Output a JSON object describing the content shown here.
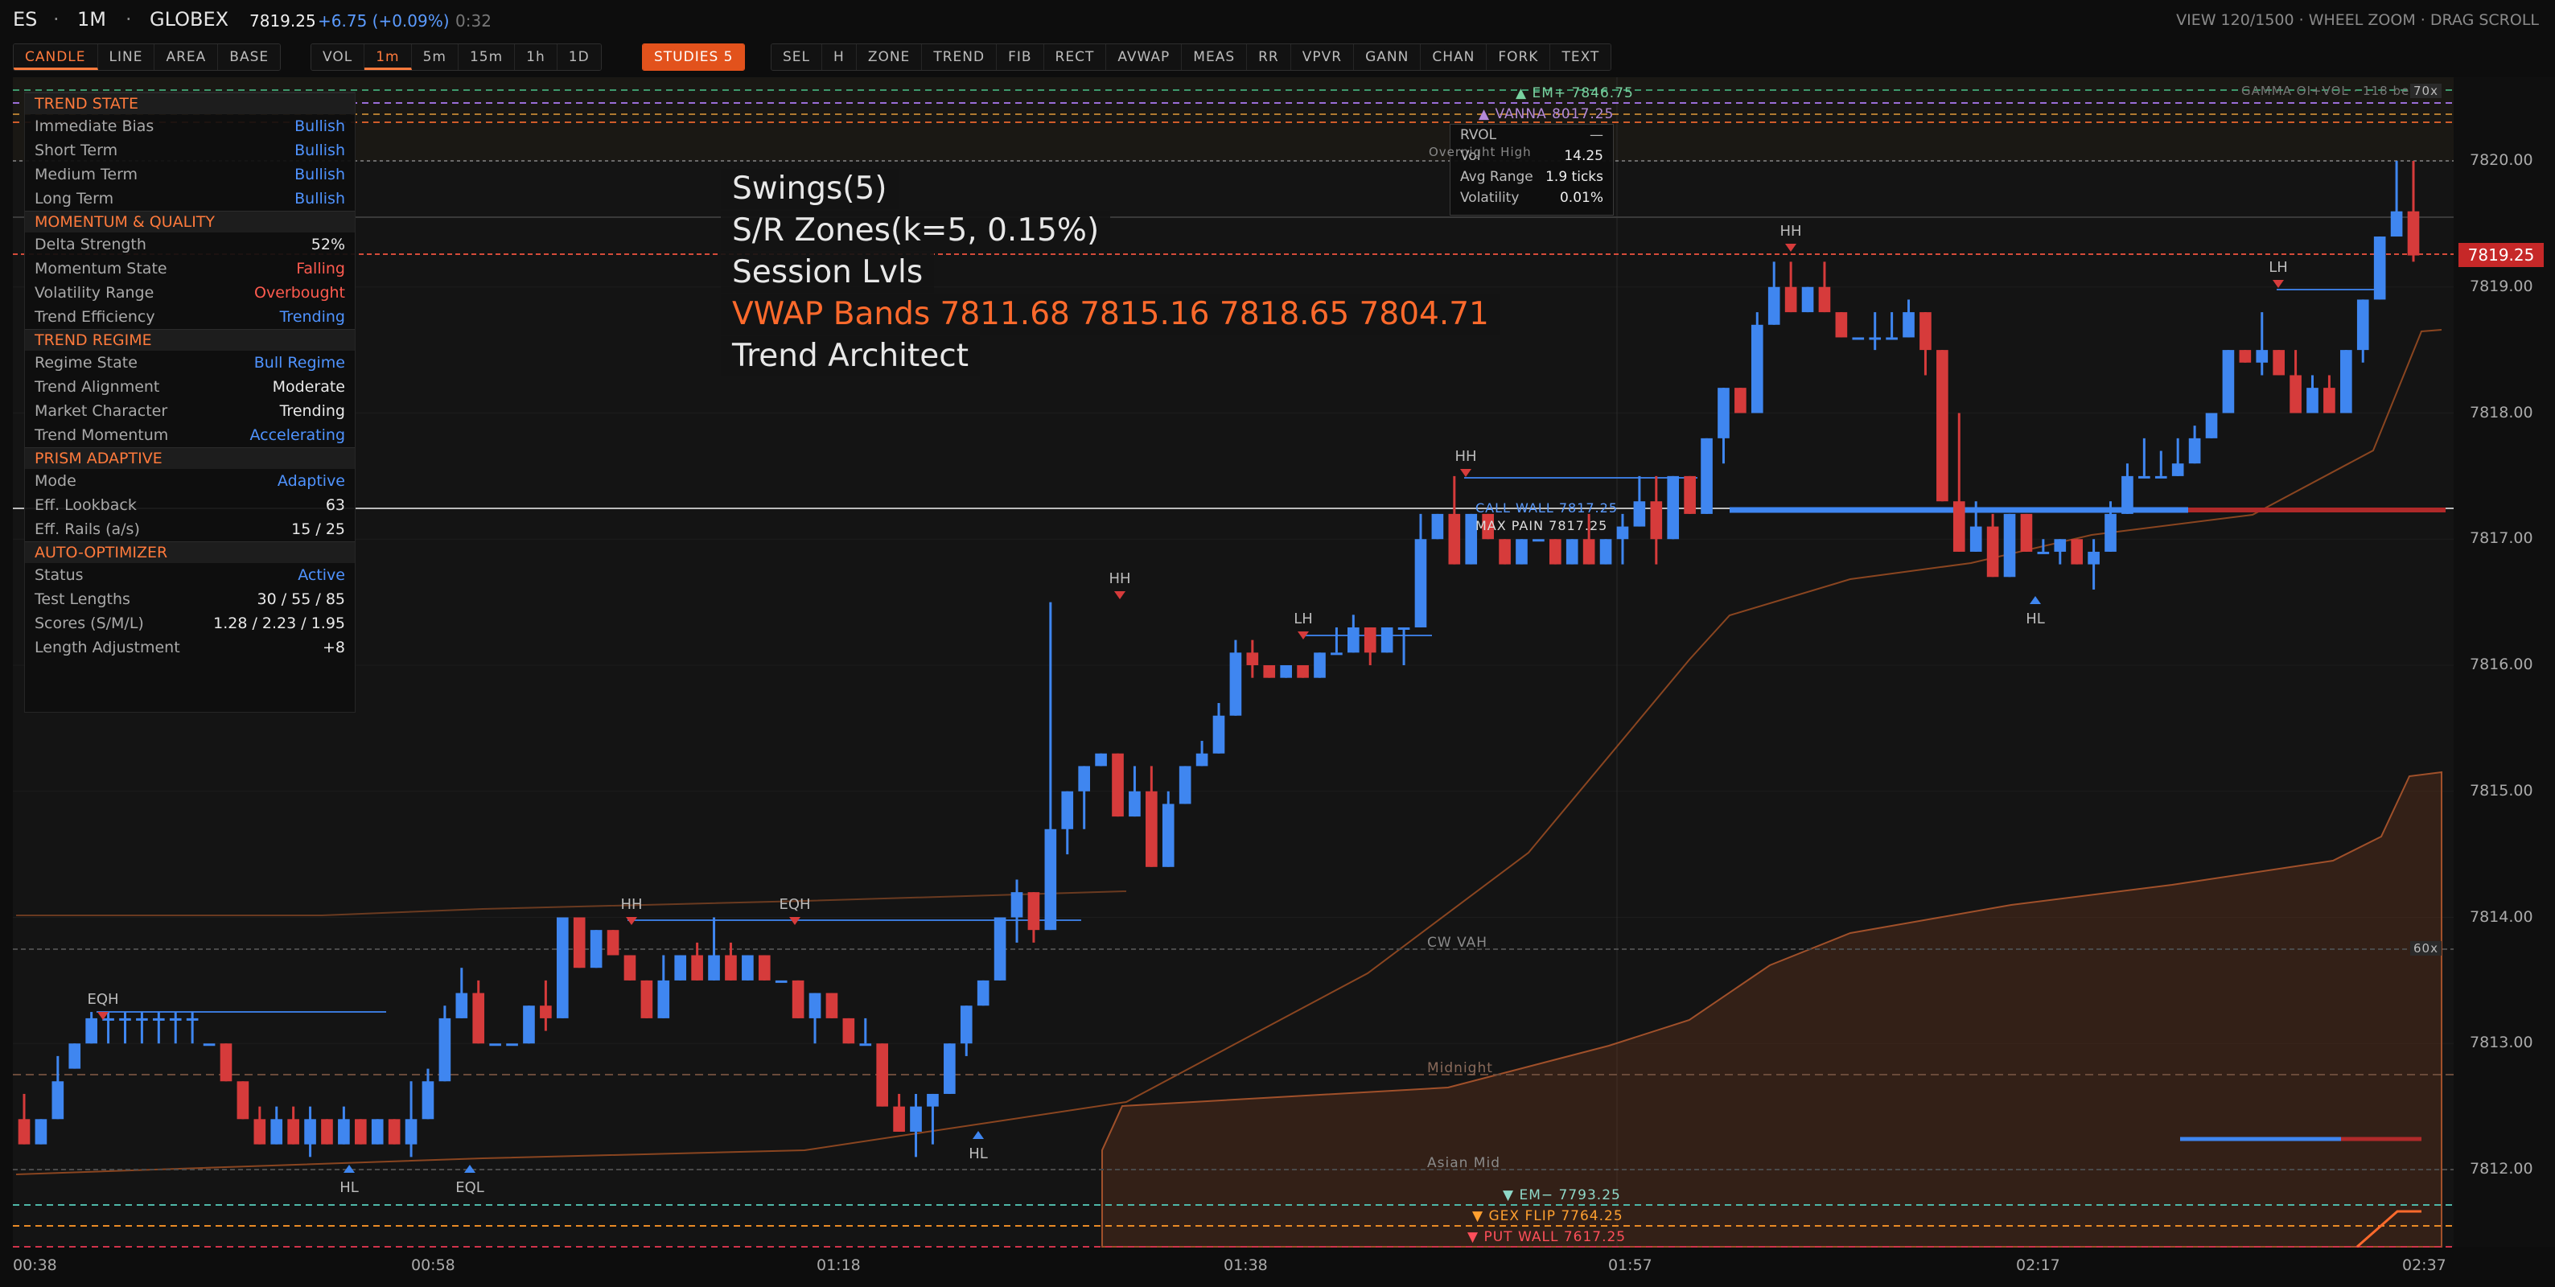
{
  "header": {
    "symbol": "ES",
    "sep": "·",
    "timeframe": "1M",
    "exchange": "GLOBEX",
    "price": "7819.25",
    "change": "+6.75 (+0.09%)",
    "timer": "0:32",
    "right_info": "VIEW 120/1500 · WHEEL ZOOM · DRAG SCROLL"
  },
  "toolbar": {
    "chart_types": [
      "CANDLE",
      "LINE",
      "AREA",
      "BASE"
    ],
    "timeframes": [
      "VOL",
      "1m",
      "5m",
      "15m",
      "1h",
      "1D"
    ],
    "studies": "STUDIES 5",
    "tools": [
      "SEL",
      "H",
      "ZONE",
      "TREND",
      "FIB",
      "RECT",
      "AVWAP",
      "MEAS",
      "RR",
      "VPVR",
      "GANN",
      "CHAN",
      "FORK",
      "TEXT"
    ]
  },
  "panel": {
    "sections": [
      {
        "title": "TREND STATE",
        "rows": [
          [
            "Immediate Bias",
            "Bullish",
            "blue"
          ],
          [
            "Short Term",
            "Bullish",
            "blue"
          ],
          [
            "Medium Term",
            "Bullish",
            "blue"
          ],
          [
            "Long Term",
            "Bullish",
            "blue"
          ]
        ]
      },
      {
        "title": "MOMENTUM & QUALITY",
        "rows": [
          [
            "Delta Strength",
            "52%",
            "white"
          ],
          [
            "Momentum State",
            "Falling",
            "red"
          ],
          [
            "Volatility Range",
            "Overbought",
            "red"
          ],
          [
            "Trend Efficiency",
            "Trending",
            "blue"
          ]
        ]
      },
      {
        "title": "TREND REGIME",
        "rows": [
          [
            "Regime State",
            "Bull Regime",
            "blue"
          ],
          [
            "Trend Alignment",
            "Moderate",
            "white"
          ],
          [
            "Market Character",
            "Trending",
            "white"
          ],
          [
            "Trend Momentum",
            "Accelerating",
            "blue"
          ]
        ]
      },
      {
        "title": "PRISM ADAPTIVE",
        "rows": [
          [
            "Mode",
            "Adaptive",
            "blue"
          ],
          [
            "Eff. Lookback",
            "63",
            "white"
          ],
          [
            "Eff. Rails (a/s)",
            "15 / 25",
            "white"
          ]
        ]
      },
      {
        "title": "AUTO-OPTIMIZER",
        "rows": [
          [
            "Status",
            "Active",
            "blue"
          ],
          [
            "Test Lengths",
            "30 / 55 / 85",
            "white"
          ],
          [
            "Scores (S/M/L)",
            "1.28 / 2.23 / 1.95",
            "white"
          ],
          [
            "Length Adjustment",
            "+8",
            "white"
          ]
        ]
      }
    ]
  },
  "legend": {
    "swings": "Swings(5)",
    "sr": "S/R Zones(k=5, 0.15%)",
    "session": "Session Lvls",
    "vwap": "VWAP Bands  7811.68 7815.16 7818.65 7804.71",
    "trend": "Trend Architect"
  },
  "stats": {
    "rvol_label": "RVOL",
    "rvol_value": "—",
    "vol_label": "Vol",
    "vol_value": "14.25",
    "avg_label": "Avg Range",
    "avg_value": "1.9 ticks",
    "volat_label": "Volatility",
    "volat_value": "0.01%"
  },
  "levels": {
    "em_plus": "▲ EM+ 7846.75",
    "vanna": "▲ VANNA 8017.25",
    "call_wall": "CALL WALL 7817.25",
    "max_pain": "MAX PAIN 7817.25",
    "cw_vah": "CW VAH",
    "midnight": "Midnight",
    "asian_mid": "Asian Mid",
    "em_minus": "▼ EM− 7793.25",
    "gex_flip": "▼ GEX FLIP 7764.25",
    "put_wall": "▼ PUT WALL 7617.25",
    "gamma": "GAMMA OI+VOL · 118 beyon",
    "badge_70": "70x",
    "badge_60": "60x",
    "overnight": "Overnight High"
  },
  "price_tag": "7819.25",
  "chart_data": {
    "type": "candlestick",
    "x_labels": [
      "00:38",
      "00:58",
      "01:18",
      "01:38",
      "01:57",
      "02:17",
      "02:37"
    ],
    "y_ticks": [
      "7820.00",
      "7819.00",
      "7818.00",
      "7817.00",
      "7816.00",
      "7815.00",
      "7814.00",
      "7813.00",
      "7812.00"
    ],
    "ylim": [
      7811.5,
      7820.5
    ],
    "last_price": 7819.25,
    "up_color": "#3f86f0",
    "down_color": "#d63b3b",
    "candles": [
      [
        7812.4,
        7812.6,
        7812.2,
        7812.2
      ],
      [
        7812.2,
        7812.4,
        7812.2,
        7812.4
      ],
      [
        7812.4,
        7812.9,
        7812.4,
        7812.7
      ],
      [
        7812.8,
        7813.0,
        7812.8,
        7813.0
      ],
      [
        7813.0,
        7813.25,
        7813.0,
        7813.2
      ],
      [
        7813.2,
        7813.25,
        7813.0,
        7813.2
      ],
      [
        7813.2,
        7813.25,
        7813.0,
        7813.2
      ],
      [
        7813.2,
        7813.25,
        7813.0,
        7813.2
      ],
      [
        7813.2,
        7813.25,
        7813.0,
        7813.2
      ],
      [
        7813.2,
        7813.25,
        7813.0,
        7813.2
      ],
      [
        7813.2,
        7813.25,
        7813.0,
        7813.2
      ],
      [
        7813.0,
        7813.0,
        7813.0,
        7813.0
      ],
      [
        7813.0,
        7813.0,
        7812.7,
        7812.7
      ],
      [
        7812.7,
        7812.7,
        7812.4,
        7812.4
      ],
      [
        7812.4,
        7812.5,
        7812.2,
        7812.2
      ],
      [
        7812.2,
        7812.5,
        7812.2,
        7812.4
      ],
      [
        7812.4,
        7812.5,
        7812.2,
        7812.2
      ],
      [
        7812.2,
        7812.5,
        7812.1,
        7812.4
      ],
      [
        7812.4,
        7812.4,
        7812.2,
        7812.2
      ],
      [
        7812.2,
        7812.5,
        7812.2,
        7812.4
      ],
      [
        7812.4,
        7812.4,
        7812.2,
        7812.2
      ],
      [
        7812.2,
        7812.4,
        7812.2,
        7812.4
      ],
      [
        7812.4,
        7812.4,
        7812.2,
        7812.2
      ],
      [
        7812.2,
        7812.7,
        7812.1,
        7812.4
      ],
      [
        7812.4,
        7812.8,
        7812.4,
        7812.7
      ],
      [
        7812.7,
        7813.3,
        7812.7,
        7813.2
      ],
      [
        7813.2,
        7813.6,
        7813.2,
        7813.4
      ],
      [
        7813.4,
        7813.5,
        7813.0,
        7813.0
      ],
      [
        7813.0,
        7813.0,
        7813.0,
        7813.0
      ],
      [
        7813.0,
        7813.0,
        7813.0,
        7813.0
      ],
      [
        7813.0,
        7813.3,
        7813.0,
        7813.3
      ],
      [
        7813.3,
        7813.5,
        7813.1,
        7813.2
      ],
      [
        7813.2,
        7814.0,
        7813.2,
        7814.0
      ],
      [
        7814.0,
        7814.0,
        7813.6,
        7813.6
      ],
      [
        7813.6,
        7813.9,
        7813.6,
        7813.9
      ],
      [
        7813.9,
        7813.9,
        7813.7,
        7813.7
      ],
      [
        7813.7,
        7813.7,
        7813.5,
        7813.5
      ],
      [
        7813.5,
        7813.5,
        7813.2,
        7813.2
      ],
      [
        7813.2,
        7813.7,
        7813.2,
        7813.5
      ],
      [
        7813.5,
        7813.7,
        7813.5,
        7813.7
      ],
      [
        7813.7,
        7813.8,
        7813.5,
        7813.5
      ],
      [
        7813.5,
        7814.0,
        7813.5,
        7813.7
      ],
      [
        7813.7,
        7813.8,
        7813.5,
        7813.5
      ],
      [
        7813.5,
        7813.7,
        7813.5,
        7813.7
      ],
      [
        7813.7,
        7813.7,
        7813.5,
        7813.5
      ],
      [
        7813.5,
        7813.5,
        7813.5,
        7813.5
      ],
      [
        7813.5,
        7813.5,
        7813.2,
        7813.2
      ],
      [
        7813.2,
        7813.4,
        7813.0,
        7813.4
      ],
      [
        7813.4,
        7813.4,
        7813.2,
        7813.2
      ],
      [
        7813.2,
        7813.2,
        7813.0,
        7813.0
      ],
      [
        7813.0,
        7813.2,
        7813.0,
        7813.0
      ],
      [
        7813.0,
        7813.0,
        7812.5,
        7812.5
      ],
      [
        7812.5,
        7812.6,
        7812.3,
        7812.3
      ],
      [
        7812.3,
        7812.6,
        7812.1,
        7812.5
      ],
      [
        7812.5,
        7812.6,
        7812.2,
        7812.6
      ],
      [
        7812.6,
        7813.0,
        7812.6,
        7813.0
      ],
      [
        7813.0,
        7813.3,
        7812.9,
        7813.3
      ],
      [
        7813.3,
        7813.5,
        7813.3,
        7813.5
      ],
      [
        7813.5,
        7814.0,
        7813.5,
        7814.0
      ],
      [
        7814.0,
        7814.3,
        7813.8,
        7814.2
      ],
      [
        7814.2,
        7814.2,
        7813.8,
        7813.9
      ],
      [
        7813.9,
        7816.5,
        7813.9,
        7814.7
      ],
      [
        7814.7,
        7815.0,
        7814.5,
        7815.0
      ],
      [
        7815.0,
        7815.2,
        7814.7,
        7815.2
      ],
      [
        7815.2,
        7815.3,
        7815.2,
        7815.3
      ],
      [
        7815.3,
        7815.3,
        7814.8,
        7814.8
      ],
      [
        7814.8,
        7815.2,
        7814.8,
        7815.0
      ],
      [
        7815.0,
        7815.2,
        7814.4,
        7814.4
      ],
      [
        7814.4,
        7815.0,
        7814.4,
        7814.9
      ],
      [
        7814.9,
        7815.2,
        7814.9,
        7815.2
      ],
      [
        7815.2,
        7815.4,
        7815.2,
        7815.3
      ],
      [
        7815.3,
        7815.7,
        7815.3,
        7815.6
      ],
      [
        7815.6,
        7816.2,
        7815.6,
        7816.1
      ],
      [
        7816.1,
        7816.2,
        7815.9,
        7816.0
      ],
      [
        7816.0,
        7816.0,
        7815.9,
        7815.9
      ],
      [
        7815.9,
        7816.0,
        7815.9,
        7816.0
      ],
      [
        7816.0,
        7816.0,
        7815.9,
        7815.9
      ],
      [
        7815.9,
        7816.1,
        7815.9,
        7816.1
      ],
      [
        7816.1,
        7816.3,
        7816.1,
        7816.1
      ],
      [
        7816.1,
        7816.4,
        7816.1,
        7816.3
      ],
      [
        7816.3,
        7816.3,
        7816.0,
        7816.1
      ],
      [
        7816.1,
        7816.3,
        7816.1,
        7816.3
      ],
      [
        7816.3,
        7816.3,
        7816.0,
        7816.3
      ],
      [
        7816.3,
        7817.2,
        7816.3,
        7817.0
      ],
      [
        7817.0,
        7817.2,
        7817.0,
        7817.2
      ],
      [
        7817.2,
        7817.5,
        7816.8,
        7816.8
      ],
      [
        7816.8,
        7817.2,
        7816.8,
        7817.2
      ],
      [
        7817.2,
        7817.2,
        7817.0,
        7817.0
      ],
      [
        7817.0,
        7817.0,
        7816.8,
        7816.8
      ],
      [
        7816.8,
        7817.0,
        7816.8,
        7817.0
      ],
      [
        7817.0,
        7817.0,
        7817.0,
        7817.0
      ],
      [
        7817.0,
        7817.0,
        7816.8,
        7816.8
      ],
      [
        7816.8,
        7817.0,
        7816.8,
        7817.0
      ],
      [
        7817.0,
        7817.2,
        7816.8,
        7816.8
      ],
      [
        7816.8,
        7817.0,
        7816.8,
        7817.0
      ],
      [
        7817.0,
        7817.2,
        7816.8,
        7817.1
      ],
      [
        7817.1,
        7817.5,
        7817.1,
        7817.3
      ],
      [
        7817.3,
        7817.5,
        7816.8,
        7817.0
      ],
      [
        7817.0,
        7817.5,
        7817.0,
        7817.5
      ],
      [
        7817.5,
        7817.5,
        7817.2,
        7817.2
      ],
      [
        7817.2,
        7817.8,
        7817.2,
        7817.8
      ],
      [
        7817.8,
        7818.2,
        7817.6,
        7818.2
      ],
      [
        7818.2,
        7818.2,
        7818.0,
        7818.0
      ],
      [
        7818.0,
        7818.8,
        7818.0,
        7818.7
      ],
      [
        7818.7,
        7819.2,
        7818.7,
        7819.0
      ],
      [
        7819.0,
        7819.2,
        7818.8,
        7818.8
      ],
      [
        7818.8,
        7819.0,
        7818.8,
        7819.0
      ],
      [
        7819.0,
        7819.2,
        7818.8,
        7818.8
      ],
      [
        7818.8,
        7818.8,
        7818.6,
        7818.6
      ],
      [
        7818.6,
        7818.6,
        7818.6,
        7818.6
      ],
      [
        7818.6,
        7818.8,
        7818.5,
        7818.6
      ],
      [
        7818.6,
        7818.8,
        7818.6,
        7818.6
      ],
      [
        7818.6,
        7818.9,
        7818.6,
        7818.8
      ],
      [
        7818.8,
        7818.8,
        7818.3,
        7818.5
      ],
      [
        7818.5,
        7818.5,
        7817.3,
        7817.3
      ],
      [
        7817.3,
        7818.0,
        7816.9,
        7816.9
      ],
      [
        7816.9,
        7817.3,
        7816.9,
        7817.1
      ],
      [
        7817.1,
        7817.2,
        7816.7,
        7816.7
      ],
      [
        7816.7,
        7817.2,
        7816.7,
        7817.2
      ],
      [
        7817.2,
        7817.2,
        7816.9,
        7816.9
      ],
      [
        7816.9,
        7817.0,
        7816.9,
        7816.9
      ],
      [
        7816.9,
        7817.0,
        7816.8,
        7817.0
      ],
      [
        7817.0,
        7817.0,
        7816.8,
        7816.8
      ],
      [
        7816.8,
        7817.0,
        7816.6,
        7816.9
      ],
      [
        7816.9,
        7817.3,
        7816.9,
        7817.2
      ],
      [
        7817.2,
        7817.6,
        7817.2,
        7817.5
      ],
      [
        7817.5,
        7817.8,
        7817.5,
        7817.5
      ],
      [
        7817.5,
        7817.7,
        7817.5,
        7817.5
      ],
      [
        7817.5,
        7817.8,
        7817.5,
        7817.6
      ],
      [
        7817.6,
        7817.9,
        7817.6,
        7817.8
      ],
      [
        7817.8,
        7818.0,
        7817.8,
        7818.0
      ],
      [
        7818.0,
        7818.5,
        7818.0,
        7818.5
      ],
      [
        7818.5,
        7818.5,
        7818.4,
        7818.4
      ],
      [
        7818.4,
        7818.8,
        7818.3,
        7818.5
      ],
      [
        7818.5,
        7818.5,
        7818.3,
        7818.3
      ],
      [
        7818.3,
        7818.5,
        7818.0,
        7818.0
      ],
      [
        7818.0,
        7818.3,
        7818.0,
        7818.2
      ],
      [
        7818.2,
        7818.3,
        7818.0,
        7818.0
      ],
      [
        7818.0,
        7818.5,
        7818.0,
        7818.5
      ],
      [
        7818.5,
        7818.9,
        7818.4,
        7818.9
      ],
      [
        7818.9,
        7819.4,
        7818.9,
        7819.4
      ],
      [
        7819.4,
        7820.0,
        7819.4,
        7819.6
      ],
      [
        7819.6,
        7820.0,
        7819.2,
        7819.25
      ]
    ]
  }
}
